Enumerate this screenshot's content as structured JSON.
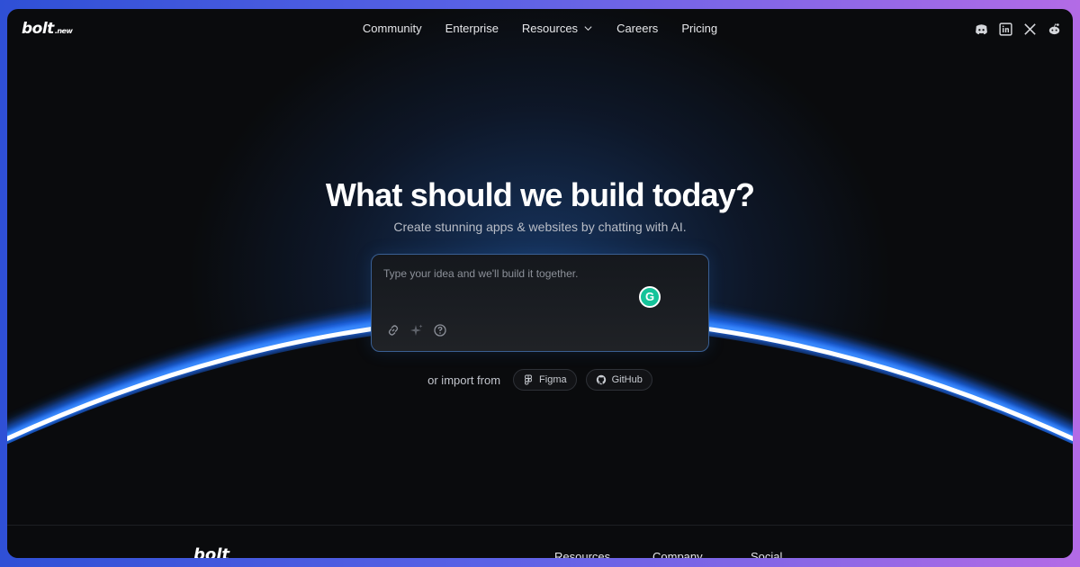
{
  "brand": {
    "logo": "bolt",
    "tld": ".new"
  },
  "nav": {
    "items": [
      {
        "label": "Community"
      },
      {
        "label": "Enterprise"
      },
      {
        "label": "Resources"
      },
      {
        "label": "Careers"
      },
      {
        "label": "Pricing"
      }
    ]
  },
  "social": [
    "discord-icon",
    "linkedin-icon",
    "x-icon",
    "reddit-icon"
  ],
  "hero": {
    "title": "What should we build today?",
    "subtitle": "Create stunning apps & websites by chatting with AI."
  },
  "prompt": {
    "placeholder": "Type your idea and we'll build it together.",
    "grammarly_letter": "G"
  },
  "import": {
    "label": "or import from",
    "figma": "Figma",
    "github": "GitHub"
  },
  "footer": {
    "logo": "bolt",
    "columns": [
      "Resources",
      "Company",
      "Social"
    ]
  },
  "colors": {
    "background": "#0a0b0d",
    "accent_blue": "#2a7bff",
    "grammarly_green": "#15c39a"
  }
}
